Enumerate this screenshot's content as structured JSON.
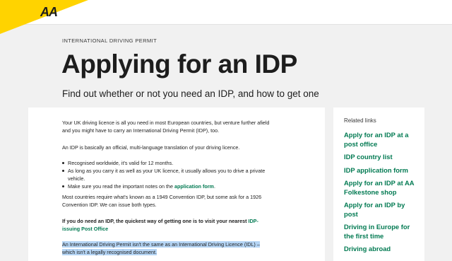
{
  "header": {
    "logo": "AA",
    "accent_color": "#ffd300"
  },
  "eyebrow": "INTERNATIONAL DRIVING PERMIT",
  "page_title": "Applying for an IDP",
  "subtitle": "Find out whether or not you need an IDP, and how to get one",
  "content": {
    "para1": "Your UK driving licence is all you need in most European countries, but venture further afield and you might have to carry an International Driving Permit (IDP), too.",
    "para2": "An IDP is basically an official, multi-language translation of your driving licence.",
    "bullets": {
      "b1": "Recognised worldwide, it's valid for 12 months.",
      "b2": "As long as you carry it as well as your UK licence, it usually allows you to drive a private vehicle.",
      "b3_prefix": "Make sure you read the important notes on the ",
      "b3_link": "application form",
      "b3_suffix": "."
    },
    "para3": "Most countries require what's known as a 1949 Convention IDP, but some ask for a 1926 Convention IDP. We can issue both types.",
    "para4_bold": "If you do need an IDP, the quickest way of getting one is to visit your nearest ",
    "para4_link": "IDP-issuing Post Office",
    "para5_highlighted": "An International Driving Permit isn't the same as an International Driving Licence (IDL) – which isn't a legally recognised document."
  },
  "sidebar": {
    "heading": "Related links",
    "links": [
      "Apply for an IDP at a post office",
      "IDP country list",
      "IDP application form",
      "Apply for an IDP at AA Folkestone shop",
      "Apply for an IDP by post",
      "Driving in Europe for the first time",
      "Driving abroad"
    ],
    "link_color": "#027a52"
  }
}
